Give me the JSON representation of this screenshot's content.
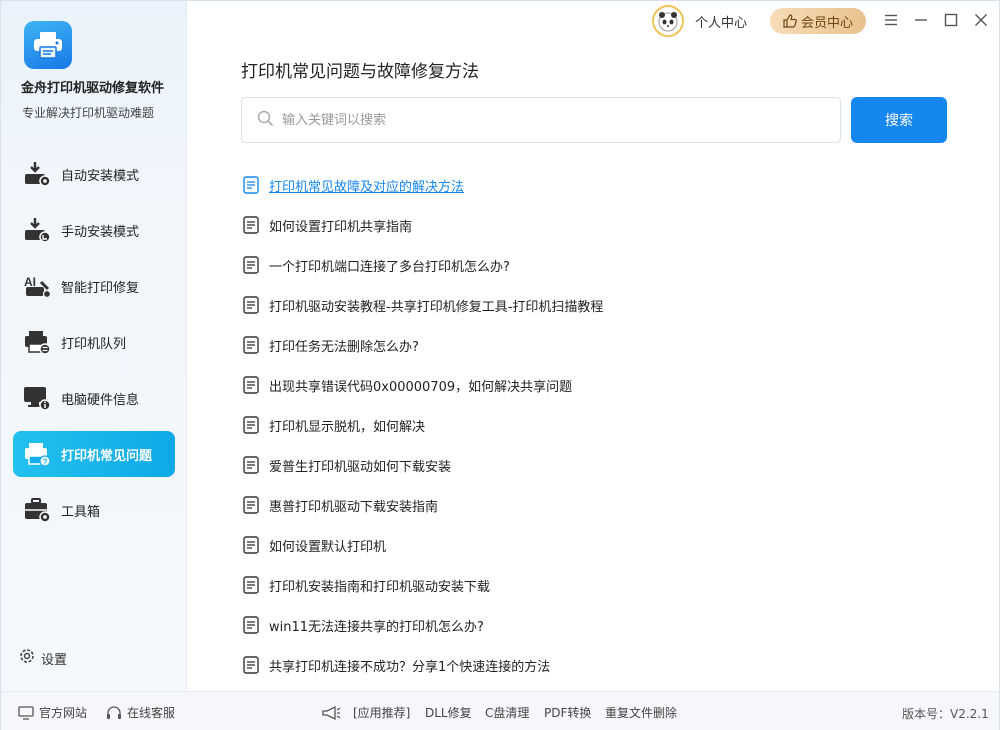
{
  "app": {
    "title": "金舟打印机驱动修复软件",
    "subtitle": "专业解决打印机驱动难题"
  },
  "topbar": {
    "personal_center": "个人中心",
    "vip_center": "会员中心"
  },
  "sidebar": {
    "items": [
      {
        "label": "自动安装模式",
        "icon": "auto-install-icon"
      },
      {
        "label": "手动安装模式",
        "icon": "manual-install-icon"
      },
      {
        "label": "智能打印修复",
        "icon": "smart-repair-icon"
      },
      {
        "label": "打印机队列",
        "icon": "print-queue-icon"
      },
      {
        "label": "电脑硬件信息",
        "icon": "hardware-info-icon"
      },
      {
        "label": "打印机常见问题",
        "icon": "printer-faq-icon",
        "active": true
      },
      {
        "label": "工具箱",
        "icon": "toolbox-icon"
      }
    ],
    "settings_label": "设置"
  },
  "main": {
    "title": "打印机常见问题与故障修复方法",
    "search": {
      "placeholder": "输入关键词以搜索",
      "button_label": "搜索"
    },
    "faq_items": [
      "打印机常见故障及对应的解决方法",
      "如何设置打印机共享指南",
      "一个打印机端口连接了多台打印机怎么办?",
      "打印机驱动安装教程-共享打印机修复工具-打印机扫描教程",
      "打印任务无法删除怎么办?",
      "出现共享错误代码0x00000709，如何解决共享问题",
      "打印机显示脱机，如何解决",
      "爱普生打印机驱动如何下载安装",
      "惠普打印机驱动下载安装指南",
      "如何设置默认打印机",
      "打印机安装指南和打印机驱动安装下载",
      "win11无法连接共享的打印机怎么办?",
      "共享打印机连接不成功？分享1个快速连接的方法"
    ]
  },
  "footer": {
    "official_site": "官方网站",
    "online_service": "在线客服",
    "app_recommend": "[应用推荐]",
    "links": [
      "DLL修复",
      "C盘清理",
      "PDF转换",
      "重复文件删除"
    ],
    "version": "版本号：V2.2.1"
  },
  "colors": {
    "accent": "#1787f0",
    "active_nav": "#17b4ec",
    "vip_gold": "#e9c18f",
    "link": "#1787f0"
  }
}
